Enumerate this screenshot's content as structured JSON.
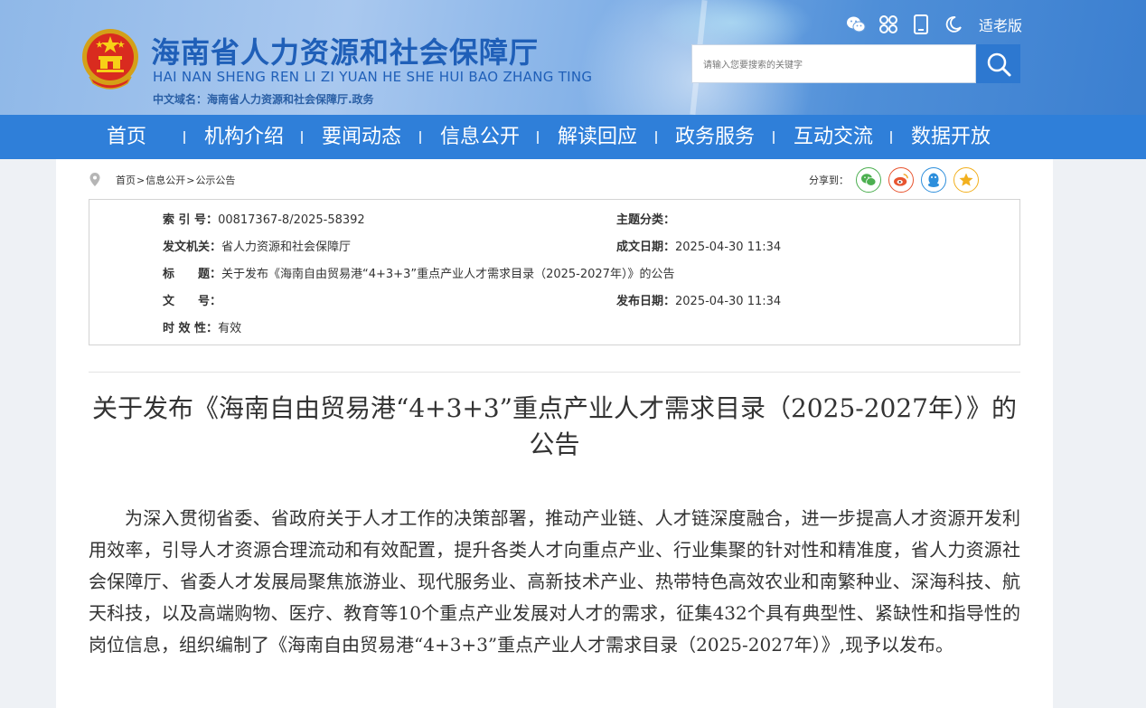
{
  "header": {
    "site_title": "海南省人力资源和社会保障厅",
    "site_pinyin": "HAI NAN SHENG REN LI ZI YUAN HE SHE HUI BAO ZHANG TING",
    "site_domain": "中文域名：海南省人力资源和社会保障厅.政务",
    "tools": [
      "wechat-icon",
      "app-grid-icon",
      "mobile-icon",
      "night-mode-icon"
    ],
    "elder_mode_label": "适老版",
    "search": {
      "placeholder": "请输入您要搜索的关键字"
    }
  },
  "nav": {
    "items": [
      {
        "label": "首页"
      },
      {
        "label": "机构介绍"
      },
      {
        "label": "要闻动态"
      },
      {
        "label": "信息公开"
      },
      {
        "label": "解读回应"
      },
      {
        "label": "政务服务"
      },
      {
        "label": "互动交流"
      },
      {
        "label": "数据开放"
      }
    ]
  },
  "breadcrumb": {
    "home": "首页",
    "sep1": " > ",
    "level1": "信息公开",
    "sep2": " > ",
    "current": "公示公告"
  },
  "share": {
    "label": "分享到：",
    "targets": [
      "wechat",
      "weibo",
      "qq",
      "qzone"
    ],
    "colors": {
      "wechat": "#4caf50",
      "weibo": "#e8542f",
      "qq": "#2e8fdc",
      "qzone": "#f2b01e"
    }
  },
  "meta": {
    "index_key": "索 引 号：",
    "index_value": "00817367-8/2025-58392",
    "topic_key": "主题分类：",
    "topic_value": "",
    "issuer_key": "发文机关：",
    "issuer_value": "省人力资源和社会保障厅",
    "created_key": "成文日期：",
    "created_value": "2025-04-30 11:34",
    "title_key": "标　　题：",
    "title_value": "关于发布《海南自由贸易港“4+3+3”重点产业人才需求目录（2025-2027年）》的公告",
    "docno_key": "文　　号：",
    "docno_value": "",
    "published_key": "发布日期：",
    "published_value": "2025-04-30 11:34",
    "validity_key": "时 效 性：",
    "validity_value": "有效"
  },
  "article": {
    "title": "关于发布《海南自由贸易港“4+3+3”重点产业人才需求目录（2025-2027年）》的公告",
    "body": "为深入贯彻省委、省政府关于人才工作的决策部署，推动产业链、人才链深度融合，进一步提高人才资源开发利用效率，引导人才资源合理流动和有效配置，提升各类人才向重点产业、行业集聚的针对性和精准度，省人力资源社会保障厅、省委人才发展局聚焦旅游业、现代服务业、高新技术产业、热带特色高效农业和南繁种业、深海科技、航天科技，以及高端购物、医疗、教育等10个重点产业发展对人才的需求，征集432个具有典型性、紧缺性和指导性的岗位信息，组织编制了《海南自由贸易港“4+3+3”重点产业人才需求目录（2025-2027年）》,现予以发布。"
  },
  "colors": {
    "nav_bg": "#2f7fd9",
    "title_blue": "#1f5fb8",
    "search_btn": "#2d78d0"
  }
}
